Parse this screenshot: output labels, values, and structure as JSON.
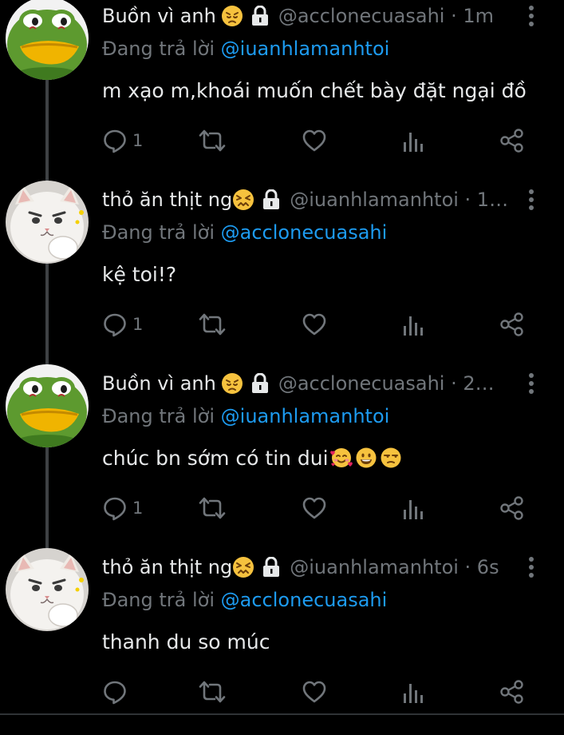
{
  "theme": {
    "background": "#000000",
    "text_primary": "#e7e9ea",
    "text_secondary": "#71767b",
    "mention_color": "#1d9bf0",
    "thread_line": "#3e4144"
  },
  "tweets": [
    {
      "avatar_icon": "frog-avatar",
      "display_name": "Buồn vì anh",
      "name_emoji": "disappointed-face-emoji",
      "handle_time": "@acclonecuasahi · 1m",
      "reply_label": "Đang trả lời",
      "reply_mention": "@iuanhlamanhtoi",
      "text": "m xạo m,khoái muốn chết bày đặt ngại đồ",
      "reply_count": "1"
    },
    {
      "avatar_icon": "cat-avatar",
      "display_name": "thỏ ăn thịt ng",
      "name_emoji": "confounded-face-emoji",
      "handle_time": "@iuanhlamanhtoi · 1…",
      "reply_label": "Đang trả lời",
      "reply_mention": "@acclonecuasahi",
      "text": "kệ toi!?",
      "reply_count": "1"
    },
    {
      "avatar_icon": "frog-avatar",
      "display_name": "Buồn vì anh",
      "name_emoji": "disappointed-face-emoji",
      "handle_time": "@acclonecuasahi · 2…",
      "reply_label": "Đang trả lời",
      "reply_mention": "@iuanhlamanhtoi",
      "text": "chúc bn sớm có tin dui",
      "reply_count": "1"
    },
    {
      "avatar_icon": "cat-avatar",
      "display_name": "thỏ ăn thịt ng",
      "name_emoji": "confounded-face-emoji",
      "handle_time": "@iuanhlamanhtoi · 6s",
      "reply_label": "Đang trả lời",
      "reply_mention": "@acclonecuasahi",
      "text": "thanh du so múc",
      "reply_count": ""
    }
  ],
  "icons": {
    "reply": "reply-icon",
    "retweet": "retweet-icon",
    "like": "heart-icon",
    "views": "views-icon",
    "share": "share-icon",
    "lock": "lock-icon",
    "more": "more-vertical-icon"
  }
}
